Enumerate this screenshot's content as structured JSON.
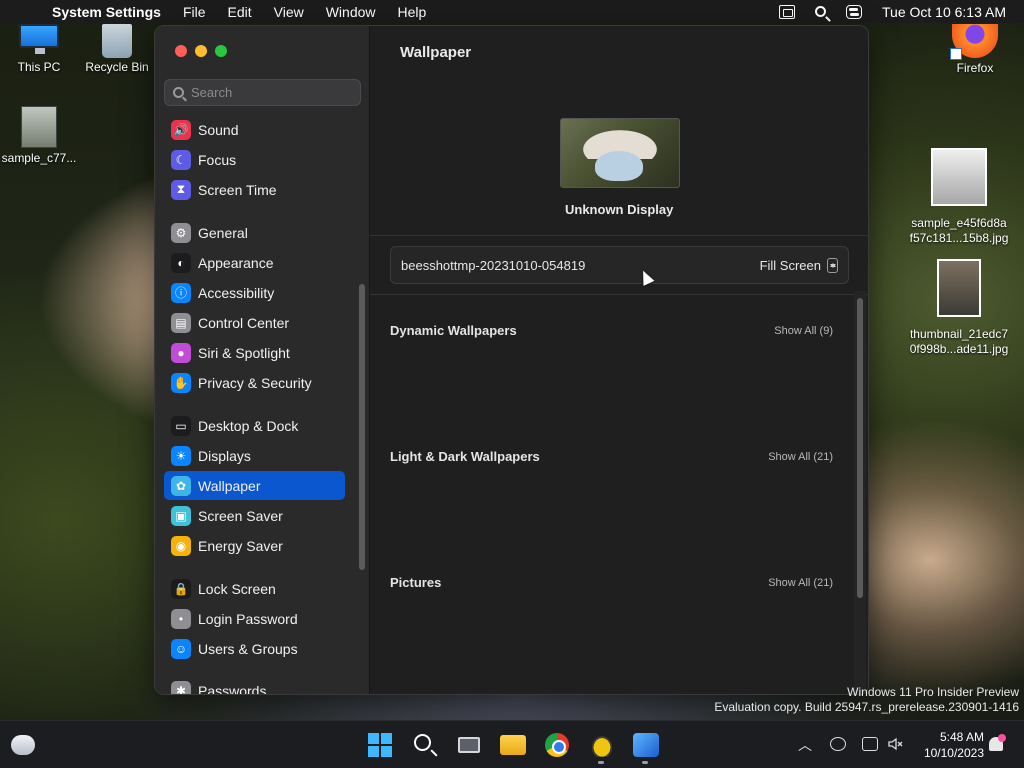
{
  "menubar": {
    "app_name": "System Settings",
    "items": [
      "File",
      "Edit",
      "View",
      "Window",
      "Help"
    ],
    "datetime": "Tue Oct 10  6:13 AM"
  },
  "desktop_icons": {
    "this_pc": "This PC",
    "recycle_bin": "Recycle Bin",
    "sample_left": "sample_c77...",
    "firefox": "Firefox",
    "sample_right": "sample_e45f6d8a\nf57c181...15b8.jpg",
    "thumbnail_right": "thumbnail_21edc7\n0f998b...ade11.jpg"
  },
  "sidebar": {
    "search_placeholder": "Search",
    "items": [
      {
        "label": "Sound",
        "icon": "speaker-icon",
        "color": "#e8344e"
      },
      {
        "label": "Focus",
        "icon": "moon-icon",
        "color": "#5e5ce6"
      },
      {
        "label": "Screen Time",
        "icon": "hourglass-icon",
        "color": "#5e5ce6"
      },
      {
        "label": "General",
        "icon": "gear-icon",
        "color": "#8e8e93"
      },
      {
        "label": "Appearance",
        "icon": "appearance-icon",
        "color": "#1c1c1e"
      },
      {
        "label": "Accessibility",
        "icon": "accessibility-icon",
        "color": "#0a84ff"
      },
      {
        "label": "Control Center",
        "icon": "control-center-icon",
        "color": "#8e8e93"
      },
      {
        "label": "Siri & Spotlight",
        "icon": "siri-icon",
        "color": "#c04cd8"
      },
      {
        "label": "Privacy & Security",
        "icon": "hand-icon",
        "color": "#0a84ff"
      },
      {
        "label": "Desktop & Dock",
        "icon": "dock-icon",
        "color": "#1c1c1e"
      },
      {
        "label": "Displays",
        "icon": "sun-icon",
        "color": "#0a84ff"
      },
      {
        "label": "Wallpaper",
        "icon": "flower-icon",
        "color": "#3db5e8"
      },
      {
        "label": "Screen Saver",
        "icon": "screensaver-icon",
        "color": "#3fc2d8"
      },
      {
        "label": "Energy Saver",
        "icon": "bulb-icon",
        "color": "#f5b20a"
      },
      {
        "label": "Lock Screen",
        "icon": "lock-icon",
        "color": "#1c1c1e"
      },
      {
        "label": "Login Password",
        "icon": "key-icon",
        "color": "#8e8e93"
      },
      {
        "label": "Users & Groups",
        "icon": "users-icon",
        "color": "#0a84ff"
      },
      {
        "label": "Passwords",
        "icon": "passwords-icon",
        "color": "#8e8e93"
      }
    ],
    "active_index": 11
  },
  "main": {
    "title": "Wallpaper",
    "display_name": "Unknown Display",
    "file_name": "beesshottmp-20231010-054819",
    "fill_mode": "Fill Screen",
    "sections": [
      {
        "title": "Dynamic Wallpapers",
        "show_all": "Show All (9)"
      },
      {
        "title": "Light & Dark Wallpapers",
        "show_all": "Show All (21)"
      },
      {
        "title": "Pictures",
        "show_all": "Show All (21)"
      }
    ]
  },
  "watermark": {
    "line1": "Windows 11 Pro Insider Preview",
    "line2": "Evaluation copy. Build 25947.rs_prerelease.230901-1416"
  },
  "taskbar": {
    "time": "5:48 AM",
    "date": "10/10/2023"
  }
}
